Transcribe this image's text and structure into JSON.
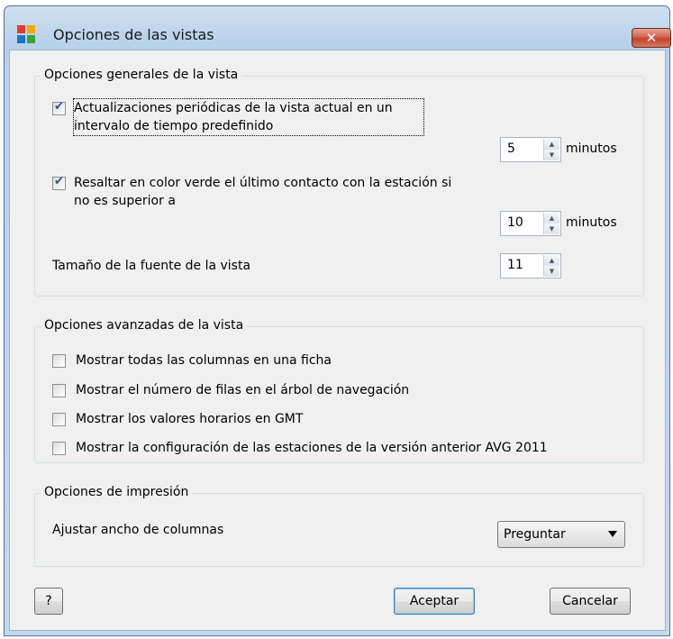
{
  "window": {
    "title": "Opciones de las vistas",
    "close_glyph": "✕"
  },
  "general": {
    "group_title": "Opciones generales de la vista",
    "periodic_update": {
      "label_line1": "Actualizaciones periódicas de la vista actual en un",
      "label_line2": "intervalo de tiempo predefinido",
      "checked": true,
      "value": "5",
      "unit": "minutos"
    },
    "highlight_green": {
      "label_line1": "Resaltar en color verde el último contacto con la estación si",
      "label_line2": "no es superior a",
      "checked": true,
      "value": "10",
      "unit": "minutos"
    },
    "font_size": {
      "label": "Tamaño de la fuente de la vista",
      "value": "11"
    }
  },
  "advanced": {
    "group_title": "Opciones avanzadas de la vista",
    "options": [
      {
        "label": "Mostrar todas las columnas en una ficha",
        "checked": false
      },
      {
        "label": "Mostrar el número de filas en el árbol de navegación",
        "checked": false
      },
      {
        "label": "Mostrar los valores horarios en GMT",
        "checked": false
      },
      {
        "label": "Mostrar la configuración de las estaciones de la versión anterior AVG 2011",
        "checked": false
      }
    ]
  },
  "print": {
    "group_title": "Opciones de impresión",
    "adjust_label": "Ajustar ancho de columnas",
    "adjust_selected": "Preguntar"
  },
  "buttons": {
    "help": "?",
    "ok": "Aceptar",
    "cancel": "Cancelar"
  },
  "icons": {
    "app": "avg-logo-icon",
    "close": "close-icon",
    "spin_up": "spin-up-icon",
    "spin_down": "spin-down-icon",
    "dropdown": "chevron-down-icon"
  },
  "colors": {
    "close_button": "#c3422c",
    "check": "#2f4f9f"
  }
}
